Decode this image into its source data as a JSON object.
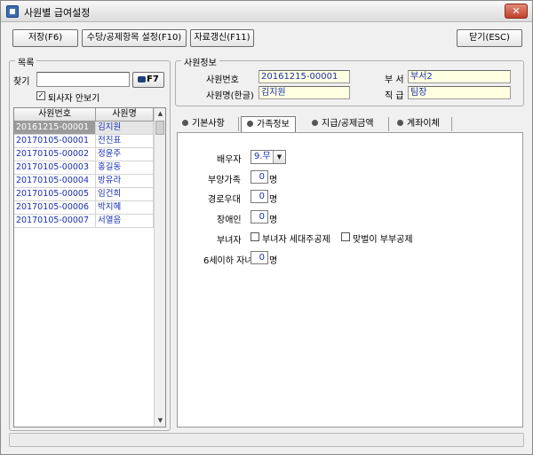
{
  "window": {
    "title": "사원별 급여설정",
    "close_label": "✕"
  },
  "toolbar": {
    "save": "저장(F6)",
    "item_settings": "수당/공제항목 설정(F10)",
    "refresh": "자료갱신(F11)",
    "close": "닫기(ESC)"
  },
  "list": {
    "title": "목록",
    "search_label": "찾기",
    "search_value": "",
    "search_button": "F7",
    "hide_retired_label": "퇴사자 안보기",
    "hide_retired_checked": true,
    "headers": [
      "사원번호",
      "사원명"
    ],
    "rows": [
      {
        "id": "20161215-00001",
        "name": "김지원",
        "selected": true
      },
      {
        "id": "20170105-00001",
        "name": "전진표"
      },
      {
        "id": "20170105-00002",
        "name": "정윤주"
      },
      {
        "id": "20170105-00003",
        "name": "홍길동"
      },
      {
        "id": "20170105-00004",
        "name": "방유라"
      },
      {
        "id": "20170105-00005",
        "name": "임건희"
      },
      {
        "id": "20170105-00006",
        "name": "박지혜"
      },
      {
        "id": "20170105-00007",
        "name": "서열음"
      }
    ]
  },
  "employee": {
    "title": "사원정보",
    "id_label": "사원번호",
    "id_value": "20161215-00001",
    "dept_label": "부 서",
    "dept_value": "부서2",
    "name_label": "사원명(한글)",
    "name_value": "김지원",
    "rank_label": "직 급",
    "rank_value": "팀장"
  },
  "tabs": [
    {
      "label": "기본사항"
    },
    {
      "label": "가족정보",
      "active": true
    },
    {
      "label": "지급/공제금액"
    },
    {
      "label": "계좌이체"
    }
  ],
  "family": {
    "spouse_label": "배우자",
    "spouse_value": "9.무",
    "dependents_label": "부양가족",
    "dependents_value": "0",
    "elderly_label": "경로우대",
    "elderly_value": "0",
    "disabled_label": "장애인",
    "disabled_value": "0",
    "woman_label": "부녀자",
    "woman_head_label": "부녀자 세대주공제",
    "dual_income_label": "맞벌이 부부공제",
    "under6_label": "6세이하 자녀",
    "under6_value": "0",
    "unit": "명"
  },
  "colors": {
    "value_text": "#1a2fb3",
    "readonly_field": "#ffffe1",
    "selected_row": "#9b9b9b"
  }
}
